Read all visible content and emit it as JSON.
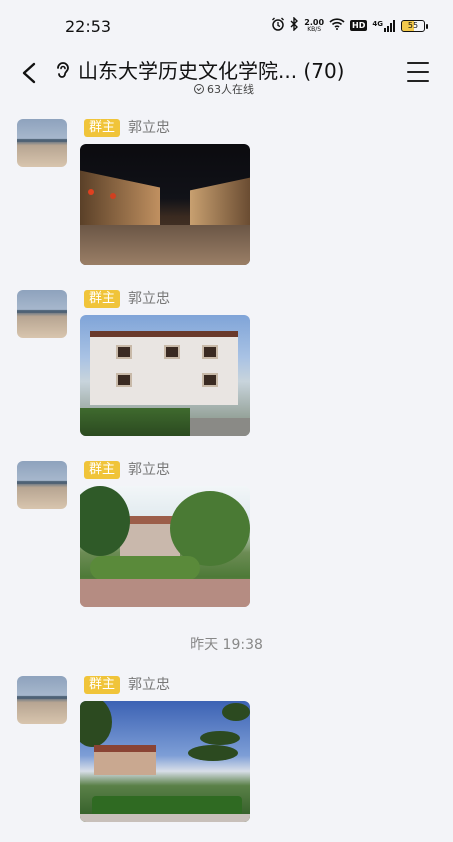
{
  "status_bar": {
    "time": "22:53",
    "speed_value": "2.00",
    "speed_unit": "KB/S",
    "network": "4G",
    "hd_label": "HD",
    "battery": "55"
  },
  "header": {
    "title": "山东大学历史文化学院... (70)",
    "online_count": "63人在线",
    "icons": [
      "chevron-left-icon",
      "ear-icon",
      "online-check-icon",
      "menu-icon"
    ]
  },
  "messages": [
    {
      "badge": "群主",
      "sender": "郭立忠",
      "photo": "night-street"
    },
    {
      "badge": "群主",
      "sender": "郭立忠",
      "photo": "villa"
    },
    {
      "badge": "群主",
      "sender": "郭立忠",
      "photo": "garden-house"
    }
  ],
  "divider_time": "昨天 19:38",
  "messages_after": [
    {
      "badge": "群主",
      "sender": "郭立忠",
      "photo": "hedge-garden"
    }
  ],
  "colors": {
    "background": "#f3f4f8",
    "badge": "#f0c43a",
    "sender_text": "#777777"
  }
}
